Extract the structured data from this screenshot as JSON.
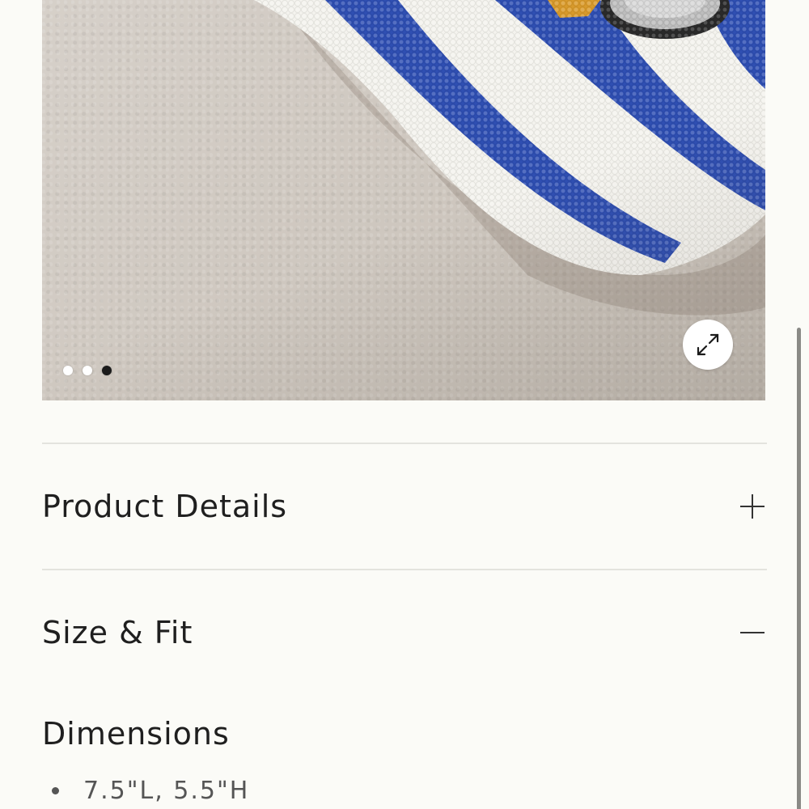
{
  "gallery": {
    "dots": [
      {
        "active": false
      },
      {
        "active": false
      },
      {
        "active": true
      }
    ],
    "expand_icon": "expand-arrows-icon",
    "colors": {
      "bead_blue": "#2f4fb3",
      "bead_white": "#f4f3ee",
      "bead_orange": "#d99a2b",
      "bead_silver": "#bfbfbf",
      "background": "#d2cbc3"
    }
  },
  "accordion": {
    "items": [
      {
        "title": "Product Details",
        "icon": "plus-icon",
        "expanded": false
      },
      {
        "title": "Size & Fit",
        "icon": "minus-icon",
        "expanded": true
      }
    ]
  },
  "size_fit": {
    "heading": "Dimensions",
    "bullets": [
      "7.5\"L, 5.5\"H"
    ]
  }
}
